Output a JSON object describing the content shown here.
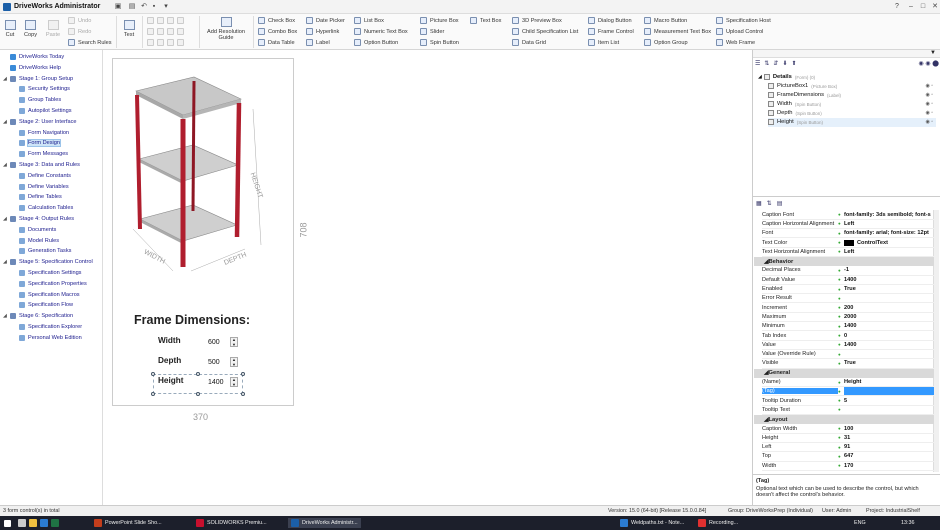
{
  "window": {
    "title": "DriveWorks Administrator"
  },
  "ribbon": {
    "cut": "Cut",
    "copy": "Copy",
    "paste": "Paste",
    "undo": "Undo",
    "redo": "Redo",
    "search_rules": "Search Rules",
    "test": "Test",
    "add_resolution_guide": "Add Resolution Guide",
    "controls": [
      {
        "label": "Check Box",
        "name": "check-box"
      },
      {
        "label": "Combo Box",
        "name": "combo-box"
      },
      {
        "label": "Data Table",
        "name": "data-table"
      },
      {
        "label": "Date Picker",
        "name": "date-picker"
      },
      {
        "label": "Hyperlink",
        "name": "hyperlink"
      },
      {
        "label": "Label",
        "name": "label"
      },
      {
        "label": "List Box",
        "name": "list-box"
      },
      {
        "label": "Numeric Text Box",
        "name": "numeric-text-box"
      },
      {
        "label": "Option Button",
        "name": "option-button"
      },
      {
        "label": "Picture Box",
        "name": "picture-box"
      },
      {
        "label": "Slider",
        "name": "slider"
      },
      {
        "label": "Spin Button",
        "name": "spin-button"
      },
      {
        "label": "Text Box",
        "name": "text-box"
      },
      {
        "label": "3D Preview Box",
        "name": "3d-preview-box"
      },
      {
        "label": "Child Specification List",
        "name": "child-spec-list"
      },
      {
        "label": "Data Grid",
        "name": "data-grid"
      },
      {
        "label": "Dialog Button",
        "name": "dialog-button"
      },
      {
        "label": "Frame Control",
        "name": "frame-control"
      },
      {
        "label": "Item List",
        "name": "item-list"
      },
      {
        "label": "Macro Button",
        "name": "macro-button"
      },
      {
        "label": "Measurement Text Box",
        "name": "measurement-text-box"
      },
      {
        "label": "Option Group",
        "name": "option-group"
      },
      {
        "label": "Specification Host",
        "name": "specification-host"
      },
      {
        "label": "Upload Control",
        "name": "upload-control"
      },
      {
        "label": "Web Frame",
        "name": "web-frame"
      }
    ]
  },
  "tree": {
    "items": [
      {
        "label": "DriveWorks Today",
        "stage": false
      },
      {
        "label": "DriveWorks Help",
        "stage": false
      },
      {
        "label": "Stage 1: Group Setup",
        "stage": true
      },
      {
        "label": "Security Settings",
        "stage": false
      },
      {
        "label": "Group Tables",
        "stage": false
      },
      {
        "label": "Autopilot Settings",
        "stage": false
      },
      {
        "label": "Stage 2: User Interface",
        "stage": true
      },
      {
        "label": "Form Navigation",
        "stage": false
      },
      {
        "label": "Form Design",
        "stage": false
      },
      {
        "label": "Form Messages",
        "stage": false
      },
      {
        "label": "Stage 3: Data and Rules",
        "stage": true
      },
      {
        "label": "Define Constants",
        "stage": false
      },
      {
        "label": "Define Variables",
        "stage": false
      },
      {
        "label": "Define Tables",
        "stage": false
      },
      {
        "label": "Calculation Tables",
        "stage": false
      },
      {
        "label": "Stage 4: Output Rules",
        "stage": true
      },
      {
        "label": "Documents",
        "stage": false
      },
      {
        "label": "Model Rules",
        "stage": false
      },
      {
        "label": "Generation Tasks",
        "stage": false
      },
      {
        "label": "Stage 5: Specification Control",
        "stage": true
      },
      {
        "label": "Specification Settings",
        "stage": false
      },
      {
        "label": "Specification Properties",
        "stage": false
      },
      {
        "label": "Specification Macros",
        "stage": false
      },
      {
        "label": "Specification Flow",
        "stage": false
      },
      {
        "label": "Stage 6: Specification",
        "stage": true
      },
      {
        "label": "Specification Explorer",
        "stage": false
      },
      {
        "label": "Personal Web Edition",
        "stage": false
      }
    ]
  },
  "form": {
    "title": "Frame Dimensions:",
    "dim_height": "708",
    "dim_width": "370",
    "drawing_labels": {
      "height": "HEIGHT",
      "width": "WIDTH",
      "depth": "DEPTH"
    },
    "fields": [
      {
        "label": "Width",
        "value": "600"
      },
      {
        "label": "Depth",
        "value": "500"
      },
      {
        "label": "Height",
        "value": "1400"
      }
    ]
  },
  "details": {
    "root": "Details",
    "root_sub": "(Form) (0)",
    "items": [
      {
        "label": "PictureBox1",
        "sub": "(Picture Box)"
      },
      {
        "label": "FrameDimensions",
        "sub": "(Label)"
      },
      {
        "label": "Width",
        "sub": "(Spin Button)"
      },
      {
        "label": "Depth",
        "sub": "(Spin Button)"
      },
      {
        "label": "Height",
        "sub": "(Spin Button)"
      }
    ]
  },
  "properties": [
    {
      "type": "row",
      "key": "Caption Font",
      "value": "font-family: 3ds semibold; font-s"
    },
    {
      "type": "row",
      "key": "Caption Horizontal Alignment",
      "value": "Left"
    },
    {
      "type": "row",
      "key": "Font",
      "value": "font-family: arial; font-size: 12pt"
    },
    {
      "type": "row",
      "key": "Text Color",
      "value": "ControlText"
    },
    {
      "type": "row",
      "key": "Text Horizontal Alignment",
      "value": "Left"
    },
    {
      "type": "head",
      "key": "Behavior"
    },
    {
      "type": "row",
      "key": "Decimal Places",
      "value": "-1"
    },
    {
      "type": "row",
      "key": "Default Value",
      "value": "1400"
    },
    {
      "type": "row",
      "key": "Enabled",
      "value": "True"
    },
    {
      "type": "row",
      "key": "Error Result",
      "value": ""
    },
    {
      "type": "row",
      "key": "Increment",
      "value": "200"
    },
    {
      "type": "row",
      "key": "Maximum",
      "value": "2000"
    },
    {
      "type": "row",
      "key": "Minimum",
      "value": "1400"
    },
    {
      "type": "row",
      "key": "Tab Index",
      "value": "0"
    },
    {
      "type": "row",
      "key": "Value",
      "value": "1400"
    },
    {
      "type": "row",
      "key": "Value (Override Rule)",
      "value": ""
    },
    {
      "type": "row",
      "key": "Visible",
      "value": "True"
    },
    {
      "type": "head",
      "key": "General"
    },
    {
      "type": "row",
      "key": "(Name)",
      "value": "Height"
    },
    {
      "type": "row",
      "key": "(Tag)",
      "value": "",
      "selected": true
    },
    {
      "type": "row",
      "key": "Tooltip Duration",
      "value": "5"
    },
    {
      "type": "row",
      "key": "Tooltip Text",
      "value": ""
    },
    {
      "type": "head",
      "key": "Layout"
    },
    {
      "type": "row",
      "key": "Caption Width",
      "value": "100"
    },
    {
      "type": "row",
      "key": "Height",
      "value": "31"
    },
    {
      "type": "row",
      "key": "Left",
      "value": "91"
    },
    {
      "type": "row",
      "key": "Top",
      "value": "647"
    },
    {
      "type": "row",
      "key": "Width",
      "value": "170"
    }
  ],
  "description": {
    "title": "(Tag)",
    "text": "Optional text which can be used to describe the control, but which doesn't affect the control's behavior."
  },
  "status": {
    "left": "3 form control(s) in total",
    "version": "Version: 15.0 (64-bit) [Release 15.0.0.84]",
    "group": "Group: DriveWorksPrep (Individual)",
    "user": "User: Admin",
    "project": "Project: IndustrialShelf"
  },
  "taskbar": {
    "items": [
      "PowerPoint Slide Sho...",
      "SOLIDWORKS Premiu...",
      "DriveWorks Administr...",
      "Weldpaths.txt - Note...",
      "Recording..."
    ],
    "lang": "ENG",
    "time": "13:36"
  },
  "colors": {
    "frame": "#b01e2e",
    "shelf": "#c8c8c8",
    "selection": "#3399ff"
  }
}
